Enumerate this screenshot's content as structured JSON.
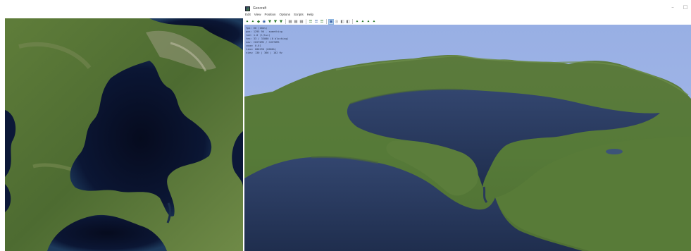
{
  "app": {
    "title": "Geocraft",
    "window_controls": [
      "–",
      "□"
    ]
  },
  "menu": [
    "Edit",
    "View",
    "Position",
    "Options",
    "Scripts",
    "Help"
  ],
  "toolbar": [
    {
      "icon": "tree-icon",
      "glyph": "⯅"
    },
    {
      "icon": "tree-icon",
      "glyph": "⯅"
    },
    {
      "icon": "terrain-icon",
      "glyph": "◆"
    },
    {
      "icon": "water-icon",
      "glyph": "◉"
    },
    {
      "icon": "brush-icon",
      "glyph": "▼"
    },
    {
      "icon": "brush-icon",
      "glyph": "▼"
    },
    {
      "icon": "brush-icon",
      "glyph": "▼"
    },
    {
      "icon": "grid-icon",
      "glyph": "▦"
    },
    {
      "icon": "grid-icon",
      "glyph": "▦"
    },
    {
      "icon": "grid-icon",
      "glyph": "▦"
    },
    {
      "icon": "layer-icon",
      "glyph": "☰"
    },
    {
      "icon": "layer-icon",
      "glyph": "☰"
    },
    {
      "icon": "layer-icon",
      "glyph": "☰"
    },
    {
      "icon": "view-3d-icon",
      "glyph": "▣"
    },
    {
      "icon": "eye-icon",
      "glyph": "◎"
    },
    {
      "icon": "camera-icon",
      "glyph": "◧"
    },
    {
      "icon": "camera-icon",
      "glyph": "◧"
    },
    {
      "icon": "tree-icon",
      "glyph": "⯅"
    },
    {
      "icon": "tree-icon",
      "glyph": "⯅"
    },
    {
      "icon": "tree-icon",
      "glyph": "⯅"
    },
    {
      "icon": "tree-icon",
      "glyph": "⯅"
    }
  ],
  "hud": [
    "fps: 60 (16ms)",
    "pos: 1295 96 - something",
    "lod: 1.0 (l/h+c)",
    "tex: 33 / 33000 (0 blocking)",
    "nav: CUSTOMS / CUSTOMS",
    "zoom: 0.61",
    "time: 000290 (0000h)",
    "view: 130 | 366 | 102 Hz"
  ]
}
